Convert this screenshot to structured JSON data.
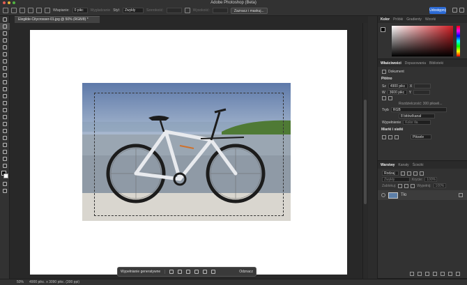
{
  "window": {
    "title": "Adobe Photoshop (Beta)"
  },
  "options_bar": {
    "feather_label": "Wtapianie:",
    "feather_value": "0 pikс",
    "antialias_label": "Wygładzanie",
    "style_label": "Styl:",
    "style_value": "Zwykły",
    "width_label": "Szerokość:",
    "height_label": "Wysokość:",
    "select_mask_button": "Zaznacz i maskuj...",
    "share_button": "Udostępnij"
  },
  "document": {
    "tab_title": "Elegilde-Citycrosser-01.jpg @ 50% (RGB/8) *"
  },
  "contextual_bar": {
    "generative_fill": "Wypełnianie generatywne",
    "cancel": "Odznacz"
  },
  "status": {
    "zoom": "50%",
    "doc_info": "4900 pikс. x 3090 pikс. (300 ppi)"
  },
  "color_panel": {
    "tabs": [
      "Kolor",
      "Próbki",
      "Gradienty",
      "Wzorki"
    ]
  },
  "properties_panel": {
    "tabs": [
      "Właściwości",
      "Dopasowania",
      "Biblioteki"
    ],
    "doc_label": "Dokument",
    "canvas_section": "Płótno",
    "width_label": "Sz",
    "width_value": "4900 pikс",
    "height_label": "W",
    "height_value": "3600 pikс",
    "x_label": "X",
    "y_label": "Y",
    "resolution": "Rozdzielczość: 300 pikseli...",
    "mode_label": "Tryb",
    "mode_value": "RGB",
    "bit_depth": "8 bitów/kanał",
    "fill_label": "Wypełnienie",
    "fill_value": "Kolor tła",
    "grid_section": "Miarki i siatki",
    "grid_unit": "Piksele"
  },
  "layers_panel": {
    "tabs": [
      "Warstwy",
      "Kanały",
      "Ścieżki"
    ],
    "kind_label": "Rodzaj",
    "mode_value": "Zwykły",
    "opacity_label": "Krycie:",
    "opacity_value": "100%",
    "lock_label": "Zablokuj:",
    "fill_label": "Wypełnij:",
    "fill_value": "100%",
    "layer_name": "Tło"
  },
  "colors": {
    "accent": "#2c6bd6",
    "picker_red": "#d01f25"
  }
}
